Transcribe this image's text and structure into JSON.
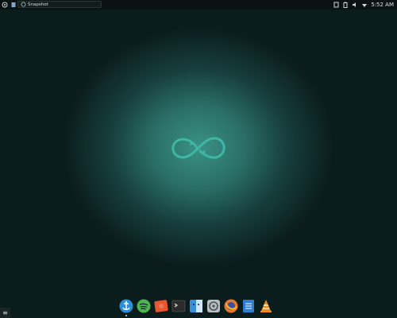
{
  "top_panel": {
    "task_label": "Snapshot",
    "clock": "5:52 AM",
    "icons": [
      "apps-menu-icon",
      "files-icon",
      "snapshot-icon",
      "clipboard-icon",
      "battery-icon",
      "volume-icon",
      "wifi-icon"
    ]
  },
  "desktop": {
    "logo": "infinity-logo",
    "accent": "#3fb7a4"
  },
  "menu_button": {
    "label": "≡"
  },
  "dock": {
    "items": [
      {
        "name": "anchor-app-icon",
        "color": "#2d8fd6",
        "running": true
      },
      {
        "name": "spotify-icon",
        "color": "#4cb64c"
      },
      {
        "name": "photo-editor-icon",
        "color": "#e8552f"
      },
      {
        "name": "terminal-icon",
        "color": "#2b2b2b"
      },
      {
        "name": "finder-icon",
        "color": "#3a8fd9"
      },
      {
        "name": "settings-icon",
        "color": "#b7bdc2"
      },
      {
        "name": "firefox-icon",
        "color": "#e9782b"
      },
      {
        "name": "notes-icon",
        "color": "#2f7fd0"
      },
      {
        "name": "vlc-icon",
        "color": "#f28c1a"
      }
    ]
  }
}
